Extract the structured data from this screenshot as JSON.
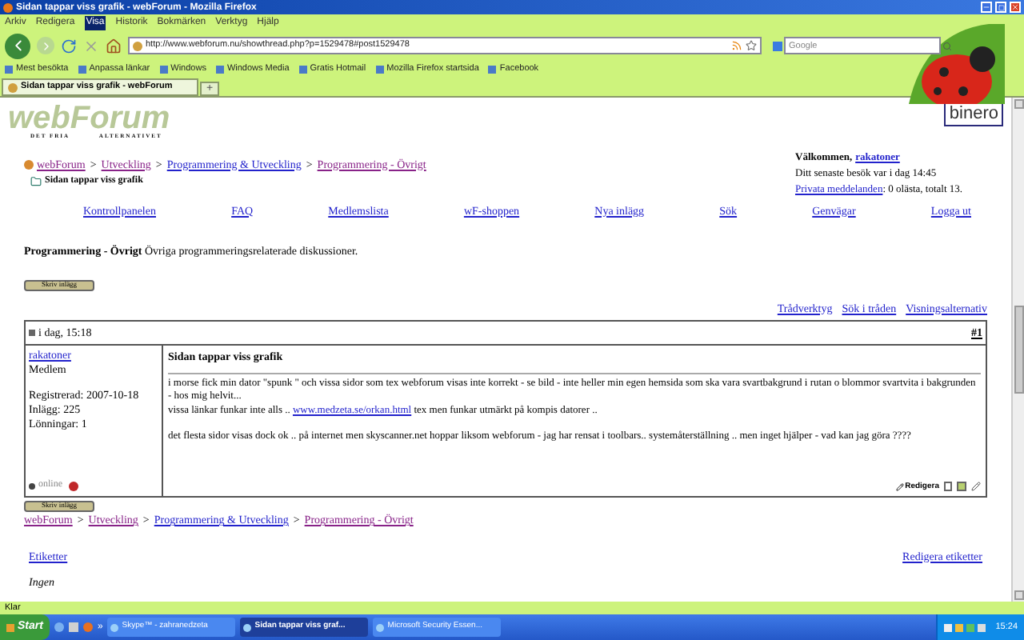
{
  "window": {
    "title": "Sidan tappar viss grafik - webForum - Mozilla Firefox"
  },
  "menu": [
    {
      "label": "Arkiv",
      "selected": false
    },
    {
      "label": "Redigera",
      "selected": false
    },
    {
      "label": "Visa",
      "selected": true
    },
    {
      "label": "Historik",
      "selected": false
    },
    {
      "label": "Bokmärken",
      "selected": false
    },
    {
      "label": "Verktyg",
      "selected": false
    },
    {
      "label": "Hjälp",
      "selected": false
    }
  ],
  "address": {
    "url": "http://www.webforum.nu/showthread.php?p=1529478#post1529478"
  },
  "search": {
    "placeholder": "Google"
  },
  "bookmarks": [
    "Mest besökta",
    "Anpassa länkar",
    "Windows",
    "Windows Media",
    "Gratis Hotmail",
    "Mozilla Firefox startsida",
    "Facebook"
  ],
  "tabs": [
    {
      "label": "Sidan tappar viss grafik - webForum",
      "selected": true
    }
  ],
  "new_tab": "+",
  "page": {
    "logo": {
      "name": "webForum",
      "tagline": "DET FRIA          ALTERNATIVET"
    },
    "sponsor": "binero",
    "breadcrumb": [
      "webForum",
      "Utveckling",
      "Programmering & Utveckling",
      "Programmering - Övrigt"
    ],
    "breadcrumb_separator": ">",
    "current_thread": "Sidan tappar viss grafik",
    "welcome": {
      "greeting": "Välkommen,",
      "user": "rakatoner",
      "last_visit": "Ditt senaste besök var i dag 14:45",
      "pm_link": "Privata meddelanden",
      "pm_status": ": 0 olästa, totalt 13."
    },
    "nav_links": [
      "Kontrollpanelen",
      "FAQ",
      "Medlemslista",
      "wF-shoppen",
      "Nya inlägg",
      "Sök",
      "Genvägar",
      "Logga ut"
    ],
    "forum": {
      "name": "Programmering - Övrigt",
      "description": "Övriga programmeringsrelaterade diskussioner."
    },
    "new_post_button": "Skriv inlägg",
    "thread_tools": [
      "Trådverktyg",
      "Sök i tråden",
      "Visningsalternativ"
    ],
    "post": {
      "date": "i dag, 15:18",
      "number": "#1",
      "user": "rakatoner",
      "rank": "Medlem",
      "stats": [
        "Registrerad: 2007-10-18",
        "Inlägg: 225",
        "Lönningar: 1"
      ],
      "title": "Sidan tappar viss grafik",
      "body": [
        [
          {
            "kind": "text",
            "text": "i morse fick min dator \"spunk \" och vissa sidor som tex webforum visas inte korrekt - se bild - inte heller min egen hemsida som ska vara svartbakgrund i rutan o blommor svartvita i bakgrunden - hos mig helvit..."
          }
        ],
        [
          {
            "kind": "text",
            "text": "vissa länkar funkar inte alls .. "
          },
          {
            "kind": "link",
            "text": "www.medzeta.se/orkan.html"
          },
          {
            "kind": "text",
            "text": " tex men funkar utmärkt på kompis datorer .."
          }
        ],
        [
          {
            "kind": "text",
            "text": "det flesta sidor visas dock ok .. på internet men skyscanner.net hoppar liksom webforum - jag har rensat i toolbars.. systemåterställning .. men inget hjälper - vad kan jag göra ????"
          }
        ]
      ],
      "status": "online",
      "online": false,
      "edit_button": "Redigera"
    },
    "bottom_button": "Skriv inlägg",
    "bottom_breadcrumb": [
      "webForum",
      "Utveckling",
      "Programmering & Utveckling",
      "Programmering - Övrigt"
    ],
    "tags_link": "Etiketter",
    "edit_tags_link": "Redigera etiketter",
    "tags_value": "Ingen"
  },
  "status_bar": "Klar",
  "taskbar": {
    "start": "Start",
    "more": "»",
    "tasks": [
      {
        "label": "Skype™ - zahranedzeta",
        "selected": false
      },
      {
        "label": "Sidan tappar viss graf...",
        "selected": true
      },
      {
        "label": "Microsoft Security Essen...",
        "selected": false
      }
    ],
    "clock": "15:24"
  }
}
